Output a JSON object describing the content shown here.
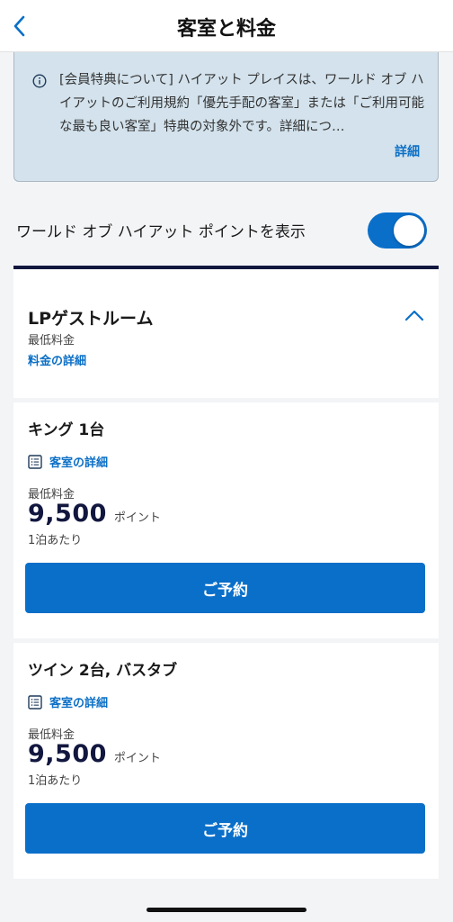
{
  "header": {
    "title": "客室と料金"
  },
  "notice": {
    "text": "[会員特典について] ハイアット プレイスは、ワールド オブ ハイアットのご利用規約「優先手配の客室」または「ご利用可能な最も良い客室」特典の対象外です。詳細につ…",
    "detail_link": "詳細"
  },
  "points_toggle": {
    "label": "ワールド オブ ハイアット ポイントを表示",
    "on": true
  },
  "room_type": {
    "name": "LPゲストルーム",
    "min_rate_label": "最低料金",
    "rate_details_link": "料金の詳細"
  },
  "rooms": [
    {
      "name": "キング 1台",
      "details_link": "客室の詳細",
      "min_rate_label": "最低料金",
      "price": "9,500",
      "unit": "ポイント",
      "per_night": "1泊あたり",
      "reserve_label": "ご予約"
    },
    {
      "name": "ツイン 2台, バスタブ",
      "details_link": "客室の詳細",
      "min_rate_label": "最低料金",
      "price": "9,500",
      "unit": "ポイント",
      "per_night": "1泊あたり",
      "reserve_label": "ご予約"
    }
  ],
  "colors": {
    "accent": "#0a6fc9",
    "navy": "#12173f",
    "notice_bg": "#d3e2ec"
  },
  "icons": [
    "back-chevron-icon",
    "info-icon",
    "chevron-up-icon",
    "list-icon"
  ]
}
